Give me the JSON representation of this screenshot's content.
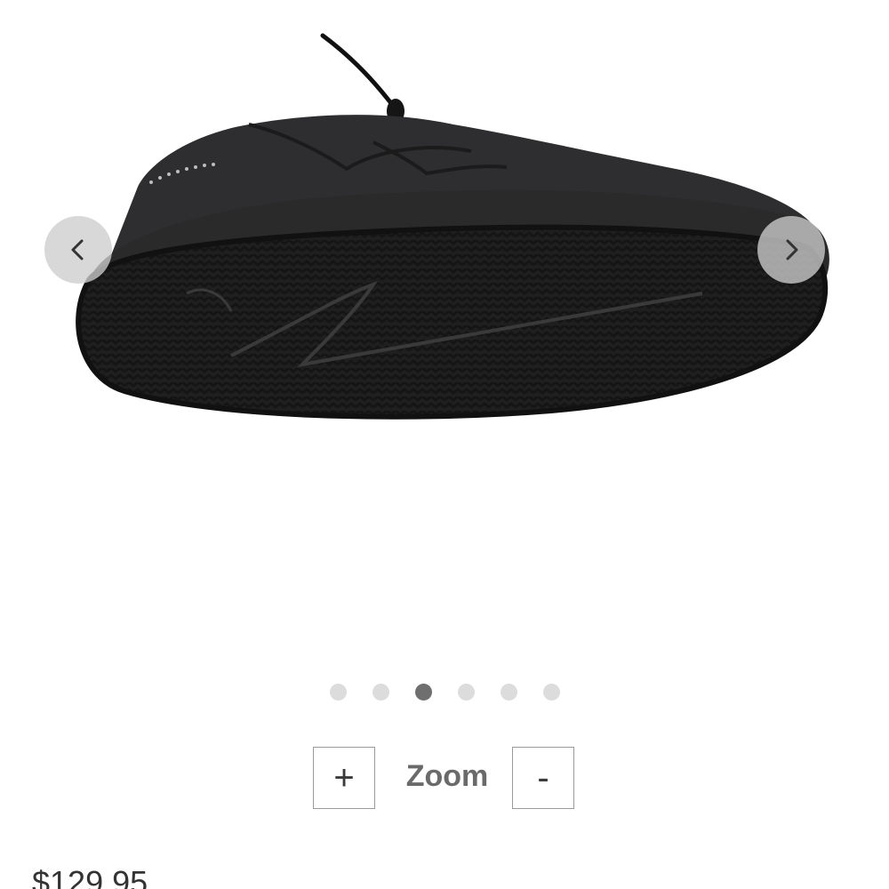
{
  "carousel": {
    "image_alt": "Black high-top sneaker, view of the sole",
    "prev_icon": "chevron-left-icon",
    "next_icon": "chevron-right-icon",
    "dot_count": 6,
    "active_index": 2
  },
  "zoom": {
    "label": "Zoom",
    "plus_label": "+",
    "minus_label": "-"
  },
  "price": {
    "value": "$129.95"
  }
}
